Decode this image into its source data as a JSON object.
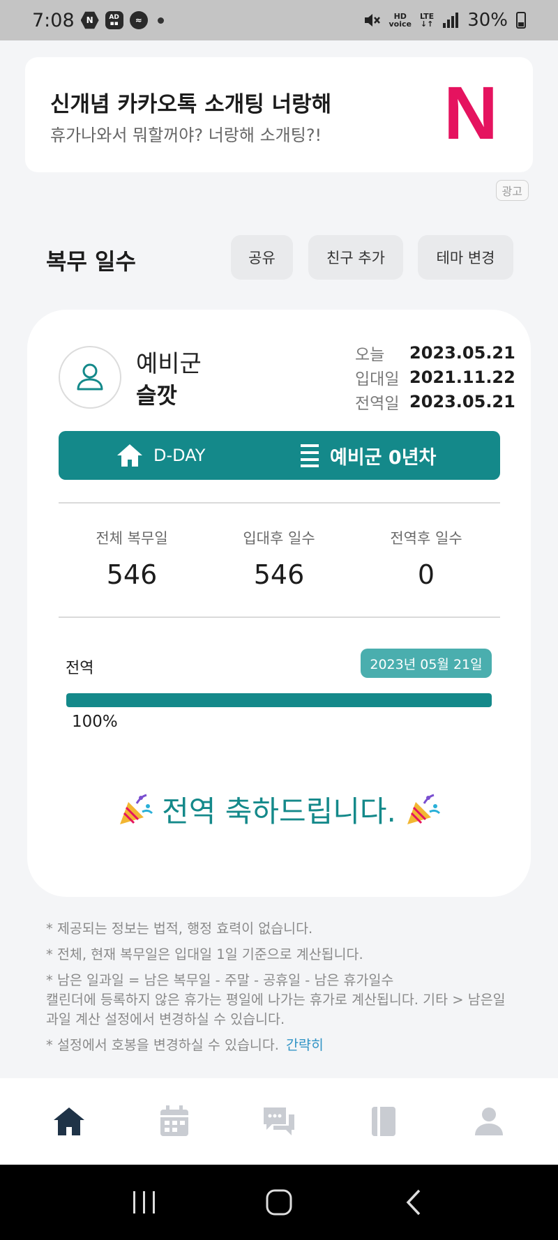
{
  "status_bar": {
    "time": "7:08",
    "battery": "30%",
    "hd_top": "HD",
    "hd_bottom": "voice",
    "lte": "LTE"
  },
  "ad": {
    "title": "신개념 카카오톡 소개팅 너랑해",
    "subtitle": "휴가나와서 뭐할꺼야? 너랑해 소개팅?!",
    "logo": "N",
    "logo_color": "#e5135f",
    "ad_label": "광고"
  },
  "header": {
    "title": "복무 일수",
    "share": "공유",
    "add_friend": "친구 추가",
    "change_theme": "테마 변경"
  },
  "profile": {
    "status": "예비군",
    "name": "슬깟",
    "dates": [
      {
        "label": "오늘",
        "value": "2023.05.21"
      },
      {
        "label": "입대일",
        "value": "2021.11.22"
      },
      {
        "label": "전역일",
        "value": "2023.05.21"
      }
    ]
  },
  "dday_bar": {
    "left_label": "D-DAY",
    "right_label": "예비군 0년차",
    "left_icon": "home-icon",
    "right_icon": "list-icon",
    "color": "#14898a"
  },
  "stats": [
    {
      "label": "전체 복무일",
      "value": "546"
    },
    {
      "label": "입대후 일수",
      "value": "546"
    },
    {
      "label": "전역후 일수",
      "value": "0"
    }
  ],
  "progress": {
    "label": "전역",
    "date_badge": "2023년 05월 21일",
    "percent_text": "100%",
    "fraction": 1.0,
    "color": "#14898a"
  },
  "congrats": {
    "text": "전역 축하드립니다.",
    "icon": "party-popper-icon"
  },
  "notes": [
    "* 제공되는 정보는 법적, 행정 효력이 없습니다.",
    "* 전체, 현재 복무일은 입대일 1일 기준으로 계산됩니다.",
    "* 남은 일과일 = 남은 복무일 - 주말 - 공휴일 - 남은 휴가일수",
    "캘린더에 등록하지 않은 휴가는 평일에 나가는 휴가로 계산됩니다. 기타 > 남은일과일 계산 설정에서 변경하실 수 있습니다.",
    "* 설정에서 호봉을 변경하실 수 있습니다."
  ],
  "notes_link": "간략히",
  "bottom_nav": [
    "home-icon",
    "calendar-icon",
    "chat-icon",
    "book-icon",
    "person-icon"
  ],
  "system_nav": [
    "recent-apps-icon",
    "home-button-icon",
    "back-icon"
  ]
}
